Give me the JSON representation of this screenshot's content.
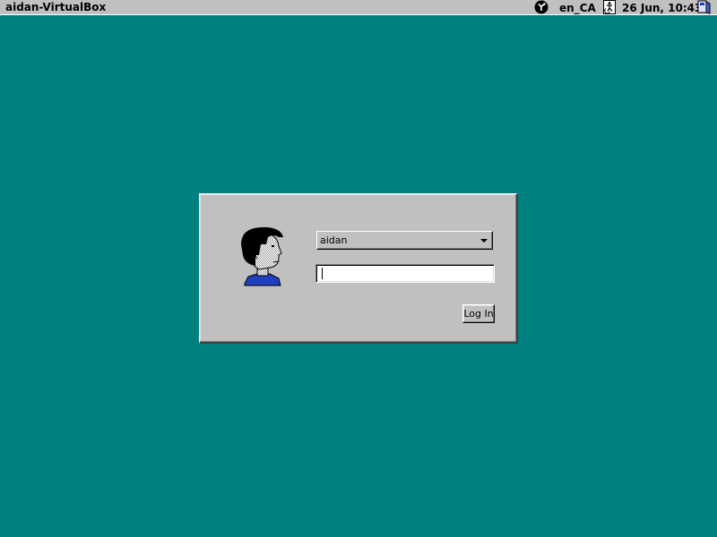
{
  "top_panel": {
    "hostname": "aidan-VirtualBox",
    "session_icon": "session-indicator-icon",
    "language": "en_CA",
    "accessibility_icon": "accessibility-icon",
    "clock": "26 Jun, 10:43",
    "power_icon": "power-icon"
  },
  "login": {
    "avatar_icon": "user-avatar-icon",
    "user_select": {
      "selected": "aidan",
      "options": [
        "aidan"
      ]
    },
    "password_field": {
      "value": ""
    },
    "login_button_label": "Log In"
  },
  "colors": {
    "desktop_bg": "#008080",
    "panel_bg": "#c0c0c0",
    "dialog_bg": "#c0c0c0",
    "avatar_shirt": "#2040c0"
  }
}
